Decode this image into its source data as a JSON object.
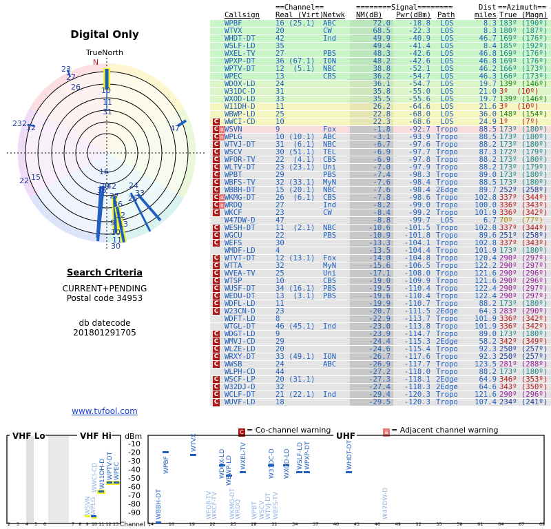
{
  "page_title": "Digital Only",
  "compass_label": "TrueNorth",
  "north_marker": "N",
  "criteria": {
    "title": "Search Criteria",
    "line1": "CURRENT+PENDING",
    "line2": "Postal code 34953",
    "line3": "db datecode",
    "line4": "201801291705"
  },
  "website": "www.tvfool.com",
  "table": {
    "group_channel": "==Channel==",
    "group_signal": "========Signal========",
    "group_dist": "Dist",
    "group_azimuth": "==Azimuth==",
    "headers": {
      "callsign": "Callsign",
      "real_virt": "Real (Virt)",
      "netwk": "Netwk",
      "nm": "NM(dB)",
      "pwr": "Pwr(dBm)",
      "path": "Path",
      "miles": "miles",
      "true_magn": "True (Magn)"
    },
    "rows": [
      {
        "cs": "WPBF",
        "rv": "16 (25.1)",
        "nw": "ABC",
        "nm": "72.0",
        "pw": "-18.8",
        "pa": "LOS",
        "di": "8.3",
        "az": "183º (190º)",
        "bg": "#c9f5c9",
        "w": ""
      },
      {
        "cs": "WTVX",
        "rv": "20",
        "nw": "CW",
        "nm": "68.5",
        "pw": "-22.3",
        "pa": "LOS",
        "di": "8.3",
        "az": "180º (187º)",
        "bg": "#c9f5c9",
        "w": ""
      },
      {
        "cs": "WHDT-DT",
        "rv": "42",
        "nw": "Ind",
        "nm": "49.9",
        "pw": "-40.9",
        "pa": "LOS",
        "di": "46.7",
        "az": "169º (176º)",
        "bg": "#c9f5c9",
        "w": ""
      },
      {
        "cs": "WSLF-LD",
        "rv": "35",
        "nw": "",
        "nm": "49.4",
        "pw": "-41.4",
        "pa": "LOS",
        "di": "8.4",
        "az": "185º (192º)",
        "bg": "#c9f5c9",
        "w": ""
      },
      {
        "cs": "WXEL-TV",
        "rv": "27",
        "nw": "PBS",
        "nm": "48.3",
        "pw": "-42.6",
        "pa": "LOS",
        "di": "46.8",
        "az": "169º (176º)",
        "bg": "#c9f5c9",
        "w": ""
      },
      {
        "cs": "WPXP-DT",
        "rv": "36 (67.1)",
        "nw": "ION",
        "nm": "48.2",
        "pw": "-42.6",
        "pa": "LOS",
        "di": "46.8",
        "az": "169º (176º)",
        "bg": "#c9f5c9",
        "w": ""
      },
      {
        "cs": "WPTV-DT",
        "rv": "12  (5.1)",
        "nw": "NBC",
        "nm": "38.8",
        "pw": "-52.1",
        "pa": "LOS",
        "di": "46.2",
        "az": "166º (173º)",
        "bg": "#c9f5c9",
        "w": ""
      },
      {
        "cs": "WPEC",
        "rv": "13",
        "nw": "CBS",
        "nm": "36.2",
        "pw": "-54.7",
        "pa": "LOS",
        "di": "46.3",
        "az": "166º (173º)",
        "bg": "#c9f5c9",
        "w": ""
      },
      {
        "cs": "WDOX-LD",
        "rv": "24",
        "nw": "",
        "nm": "36.1",
        "pw": "-54.7",
        "pa": "LOS",
        "di": "19.7",
        "az": "139º (146º)",
        "bg": "#dcf5c8",
        "w": ""
      },
      {
        "cs": "W31DC-D",
        "rv": "31",
        "nw": "",
        "nm": "35.8",
        "pw": "-55.0",
        "pa": "LOS",
        "di": "21.0",
        "az": "3º  (10º)",
        "bg": "#dcf5c8",
        "w": ""
      },
      {
        "cs": "WXOD-LD",
        "rv": "33",
        "nw": "",
        "nm": "35.5",
        "pw": "-55.6",
        "pa": "LOS",
        "di": "19.7",
        "az": "139º (146º)",
        "bg": "#dcf5c8",
        "w": ""
      },
      {
        "cs": "W11DH-D",
        "rv": "11",
        "nw": "",
        "nm": "26.2",
        "pw": "-64.6",
        "pa": "LOS",
        "di": "21.6",
        "az": "3º  (10º)",
        "bg": "#f5f5c0",
        "w": ""
      },
      {
        "cs": "WBWP-LD",
        "rv": "25",
        "nw": "",
        "nm": "22.8",
        "pw": "-68.0",
        "pa": "LOS",
        "di": "36.0",
        "az": "148º (154º)",
        "bg": "#f5f5c0",
        "w": ""
      },
      {
        "cs": "WWCI-CD",
        "rv": "10",
        "nw": "",
        "nm": "22.3",
        "pw": "-68.6",
        "pa": "LOS",
        "di": "24.9",
        "az": "1º   (7º)",
        "bg": "#f5f5c0",
        "w": "C"
      },
      {
        "cs": "WSVN",
        "rv": "9",
        "nw": "Fox",
        "nm": "-1.8",
        "pw": "-92.7",
        "pa": "Tropo",
        "di": "88.5",
        "az": "173º (180º)",
        "bg": "#f9dcdc",
        "w": "CA"
      },
      {
        "cs": "WPLG",
        "rv": "10 (10.1)",
        "nw": "ABC",
        "nm": "-3.1",
        "pw": "-93.9",
        "pa": "Tropo",
        "di": "88.5",
        "az": "173º (180º)",
        "bg": "#e4e4e4",
        "w": "CA"
      },
      {
        "cs": "WTVJ-DT",
        "rv": "31  (6.1)",
        "nw": "NBC",
        "nm": "-6.7",
        "pw": "-97.6",
        "pa": "Tropo",
        "di": "88.2",
        "az": "173º (180º)",
        "bg": "#e4e4e4",
        "w": "C"
      },
      {
        "cs": "WSCV",
        "rv": "30 (51.1)",
        "nw": "TEL",
        "nm": "-6.9",
        "pw": "-97.7",
        "pa": "Tropo",
        "di": "87.3",
        "az": "172º (179º)",
        "bg": "#e4e4e4",
        "w": "C"
      },
      {
        "cs": "WFOR-TV",
        "rv": "22  (4.1)",
        "nw": "CBS",
        "nm": "-6.9",
        "pw": "-97.8",
        "pa": "Tropo",
        "di": "88.2",
        "az": "173º (180º)",
        "bg": "#e4e4e4",
        "w": "C"
      },
      {
        "cs": "WLTV-DT",
        "rv": "23 (23.1)",
        "nw": "Uni",
        "nm": "-7.0",
        "pw": "-97.9",
        "pa": "Tropo",
        "di": "88.2",
        "az": "173º (179º)",
        "bg": "#e4e4e4",
        "w": "C"
      },
      {
        "cs": "WPBT",
        "rv": "29",
        "nw": "PBS",
        "nm": "-7.4",
        "pw": "-98.3",
        "pa": "Tropo",
        "di": "89.0",
        "az": "173º (180º)",
        "bg": "#e4e4e4",
        "w": "C"
      },
      {
        "cs": "WBFS-TV",
        "rv": "32 (33.1)",
        "nw": "MyN",
        "nm": "-7.6",
        "pw": "-98.4",
        "pa": "Tropo",
        "di": "88.5",
        "az": "173º (180º)",
        "bg": "#e4e4e4",
        "w": "C"
      },
      {
        "cs": "WBBH-DT",
        "rv": "15 (20.1)",
        "nw": "NBC",
        "nm": "-7.6",
        "pw": "-98.4",
        "pa": "2Edge",
        "di": "89.7",
        "az": "252º (258º)",
        "bg": "#e4e4e4",
        "w": "C"
      },
      {
        "cs": "WKMG-DT",
        "rv": "26  (6.1)",
        "nw": "CBS",
        "nm": "-7.8",
        "pw": "-98.6",
        "pa": "Tropo",
        "di": "102.8",
        "az": "337º (344º)",
        "bg": "#e4e4e4",
        "w": "CA"
      },
      {
        "cs": "WRDQ",
        "rv": "27",
        "nw": "Ind",
        "nm": "-8.2",
        "pw": "-99.0",
        "pa": "Tropo",
        "di": "100.0",
        "az": "336º (343º)",
        "bg": "#e4e4e4",
        "w": "CA"
      },
      {
        "cs": "WKCF",
        "rv": "23",
        "nw": "CW",
        "nm": "-8.4",
        "pw": "-99.2",
        "pa": "Tropo",
        "di": "101.9",
        "az": "336º (342º)",
        "bg": "#e4e4e4",
        "w": "C"
      },
      {
        "cs": "W47DW-D",
        "rv": "47",
        "nw": "",
        "nm": "-8.8",
        "pw": "-99.7",
        "pa": "LOS",
        "di": "6.7",
        "az": "70º  (77º)",
        "bg": "#e4e4e4",
        "w": ""
      },
      {
        "cs": "WESH-DT",
        "rv": "11  (2.1)",
        "nw": "NBC",
        "nm": "-10.6",
        "pw": "-101.5",
        "pa": "Tropo",
        "di": "102.8",
        "az": "337º (344º)",
        "bg": "#e4e4e4",
        "w": "C"
      },
      {
        "cs": "WGCU",
        "rv": "22",
        "nw": "PBS",
        "nm": "-10.9",
        "pw": "-101.8",
        "pa": "Tropo",
        "di": "89.6",
        "az": "251º (258º)",
        "bg": "#e4e4e4",
        "w": "C"
      },
      {
        "cs": "WEFS",
        "rv": "30",
        "nw": "",
        "nm": "-13.3",
        "pw": "-104.1",
        "pa": "Tropo",
        "di": "102.8",
        "az": "337º (343º)",
        "bg": "#e4e4e4",
        "w": "C"
      },
      {
        "cs": "WMDF-LD",
        "rv": "4",
        "nw": "",
        "nm": "-13.5",
        "pw": "-104.4",
        "pa": "Tropo",
        "di": "101.9",
        "az": "173º (180º)",
        "bg": "#e4e4e4",
        "w": ""
      },
      {
        "cs": "WTVT-DT",
        "rv": "12 (13.1)",
        "nw": "Fox",
        "nm": "-14.0",
        "pw": "-104.8",
        "pa": "Tropo",
        "di": "120.4",
        "az": "290º (297º)",
        "bg": "#e4e4e4",
        "w": "C"
      },
      {
        "cs": "WTTA",
        "rv": "32",
        "nw": "MyN",
        "nm": "-15.6",
        "pw": "-106.5",
        "pa": "Tropo",
        "di": "122.2",
        "az": "290º (297º)",
        "bg": "#e4e4e4",
        "w": "C"
      },
      {
        "cs": "WVEA-TV",
        "rv": "25",
        "nw": "Uni",
        "nm": "-17.1",
        "pw": "-108.0",
        "pa": "Tropo",
        "di": "121.6",
        "az": "290º (296º)",
        "bg": "#e4e4e4",
        "w": "C"
      },
      {
        "cs": "WTSP",
        "rv": "10",
        "nw": "CBS",
        "nm": "-19.0",
        "pw": "-109.9",
        "pa": "Tropo",
        "di": "121.6",
        "az": "290º (296º)",
        "bg": "#e4e4e4",
        "w": "C"
      },
      {
        "cs": "WUSF-DT",
        "rv": "34 (16.1)",
        "nw": "PBS",
        "nm": "-19.5",
        "pw": "-110.4",
        "pa": "Tropo",
        "di": "122.4",
        "az": "290º (297º)",
        "bg": "#e4e4e4",
        "w": "C"
      },
      {
        "cs": "WEDU-DT",
        "rv": "13  (3.1)",
        "nw": "PBS",
        "nm": "-19.6",
        "pw": "-110.4",
        "pa": "Tropo",
        "di": "122.4",
        "az": "290º (297º)",
        "bg": "#e4e4e4",
        "w": "C"
      },
      {
        "cs": "WDFL-LD",
        "rv": "11",
        "nw": "",
        "nm": "-19.9",
        "pw": "-110.7",
        "pa": "Tropo",
        "di": "88.2",
        "az": "173º (180º)",
        "bg": "#e4e4e4",
        "w": "C"
      },
      {
        "cs": "W23CN-D",
        "rv": "23",
        "nw": "",
        "nm": "-20.7",
        "pw": "-111.5",
        "pa": "2Edge",
        "di": "64.3",
        "az": "283º (290º)",
        "bg": "#e4e4e4",
        "w": "C"
      },
      {
        "cs": "WDFT-LD",
        "rv": "8",
        "nw": "",
        "nm": "-22.9",
        "pw": "-113.7",
        "pa": "Tropo",
        "di": "101.9",
        "az": "336º (342º)",
        "bg": "#e4e4e4",
        "w": ""
      },
      {
        "cs": "WTGL-DT",
        "rv": "46 (45.1)",
        "nw": "Ind",
        "nm": "-23.0",
        "pw": "-113.8",
        "pa": "Tropo",
        "di": "101.9",
        "az": "336º (342º)",
        "bg": "#e4e4e4",
        "w": ""
      },
      {
        "cs": "WDGT-LD",
        "rv": "9",
        "nw": "",
        "nm": "-23.9",
        "pw": "-114.7",
        "pa": "Tropo",
        "di": "89.0",
        "az": "173º (180º)",
        "bg": "#e4e4e4",
        "w": "C"
      },
      {
        "cs": "WMVJ-CD",
        "rv": "29",
        "nw": "",
        "nm": "-24.4",
        "pw": "-115.3",
        "pa": "2Edge",
        "di": "58.2",
        "az": "342º (349º)",
        "bg": "#e4e4e4",
        "w": "C"
      },
      {
        "cs": "WLZE-LD",
        "rv": "20",
        "nw": "",
        "nm": "-24.6",
        "pw": "-115.4",
        "pa": "Tropo",
        "di": "92.3",
        "az": "250º (257º)",
        "bg": "#e4e4e4",
        "w": "C"
      },
      {
        "cs": "WRXY-DT",
        "rv": "33 (49.1)",
        "nw": "ION",
        "nm": "-26.7",
        "pw": "-117.6",
        "pa": "Tropo",
        "di": "92.3",
        "az": "250º (257º)",
        "bg": "#e4e4e4",
        "w": "C"
      },
      {
        "cs": "WWSB",
        "rv": "24",
        "nw": "ABC",
        "nm": "-26.9",
        "pw": "-117.7",
        "pa": "Tropo",
        "di": "123.5",
        "az": "281º (288º)",
        "bg": "#e4e4e4",
        "w": "C"
      },
      {
        "cs": "WLPH-CD",
        "rv": "44",
        "nw": "",
        "nm": "-27.2",
        "pw": "-118.0",
        "pa": "Tropo",
        "di": "88.2",
        "az": "173º (180º)",
        "bg": "#e4e4e4",
        "w": ""
      },
      {
        "cs": "WSCF-LP",
        "rv": "20 (31.1)",
        "nw": "",
        "nm": "-27.3",
        "pw": "-118.1",
        "pa": "2Edge",
        "di": "64.9",
        "az": "346º (353º)",
        "bg": "#e4e4e4",
        "w": "C"
      },
      {
        "cs": "W32DJ-D",
        "rv": "32",
        "nw": "",
        "nm": "-27.4",
        "pw": "-118.3",
        "pa": "2Edge",
        "di": "64.6",
        "az": "343º (350º)",
        "bg": "#e4e4e4",
        "w": "C"
      },
      {
        "cs": "WCLF-DT",
        "rv": "21 (22.1)",
        "nw": "Ind",
        "nm": "-29.4",
        "pw": "-120.3",
        "pa": "Tropo",
        "di": "121.6",
        "az": "290º (296º)",
        "bg": "#e4e4e4",
        "w": "C"
      },
      {
        "cs": "WUVF-LD",
        "rv": "18",
        "nw": "",
        "nm": "-29.5",
        "pw": "-120.3",
        "pa": "Tropo",
        "di": "107.4",
        "az": "234º (241º)",
        "bg": "#e4e4e4",
        "w": "C"
      }
    ]
  },
  "legend": {
    "co_channel_icon": "C",
    "co_channel": "= Co-channel warning",
    "adjacent_icon": "a",
    "adjacent": "= Adjacent channel warning"
  },
  "spectrum": {
    "vhf_lo_label": "VHF Lo",
    "vhf_hi_label": "VHF Hi",
    "uhf_label": "UHF",
    "unit_label": "dBm",
    "channel_label": "Channel",
    "dbm_ticks": [
      -10,
      -20,
      -30,
      -40,
      -50,
      -60,
      -70,
      -80,
      -90
    ],
    "vhf_lo_channels": [
      2,
      3,
      4,
      5,
      6
    ],
    "vhf_hi_channels": [
      7,
      8,
      9,
      10,
      11,
      12,
      13
    ],
    "uhf_channels": [
      14,
      16,
      19,
      22,
      25,
      28,
      31,
      34,
      37,
      40,
      43,
      46,
      49,
      52,
      55,
      58,
      61,
      64,
      67,
      69
    ]
  },
  "radar_labels": [
    {
      "t": "10",
      "c": "#1f3f9f"
    },
    {
      "t": "11",
      "c": "#1f3f9f"
    },
    {
      "t": "31",
      "c": "#1f3f9f"
    },
    {
      "t": "23",
      "c": "#1f3f9f"
    },
    {
      "t": "27",
      "c": "#1f3f9f"
    },
    {
      "t": "26",
      "c": "#1f3f9f"
    },
    {
      "t": "47",
      "c": "#1f3f9f"
    },
    {
      "t": "2",
      "c": "#1f3f9f"
    },
    {
      "t": "32",
      "c": "#1f3f9f"
    },
    {
      "t": "12",
      "c": "#1f3f9f"
    },
    {
      "t": "22",
      "c": "#1f3f9f"
    },
    {
      "t": "15",
      "c": "#1f3f9f"
    },
    {
      "t": "16",
      "c": "#1f3f9f"
    },
    {
      "t": "20",
      "c": "#1f3f9f"
    },
    {
      "t": "42",
      "c": "#1f3f9f"
    },
    {
      "t": "35",
      "c": "#1f3f9f"
    },
    {
      "t": "27",
      "c": "#1f3f9f"
    },
    {
      "t": "24",
      "c": "#1f3f9f"
    },
    {
      "t": "33",
      "c": "#1f3f9f"
    },
    {
      "t": "36",
      "c": "#1f3f9f"
    },
    {
      "t": "25",
      "c": "#1f3f9f"
    },
    {
      "t": "12",
      "c": "#1f3f9f"
    },
    {
      "t": "13",
      "c": "#1f3f9f"
    },
    {
      "t": "9",
      "c": "#1f3f9f"
    },
    {
      "t": "10",
      "c": "#1f3f9f"
    },
    {
      "t": "11",
      "c": "#1f3f9f"
    },
    {
      "t": "30",
      "c": "#1f3f9f"
    }
  ],
  "colors": {
    "blue": "#1f5fbf",
    "dark_blue": "#1f3f9f",
    "magenta": "#9f1fa0",
    "red": "#c01818",
    "green": "#188a18",
    "orange": "#b09010",
    "highlight": "#f5f520"
  }
}
